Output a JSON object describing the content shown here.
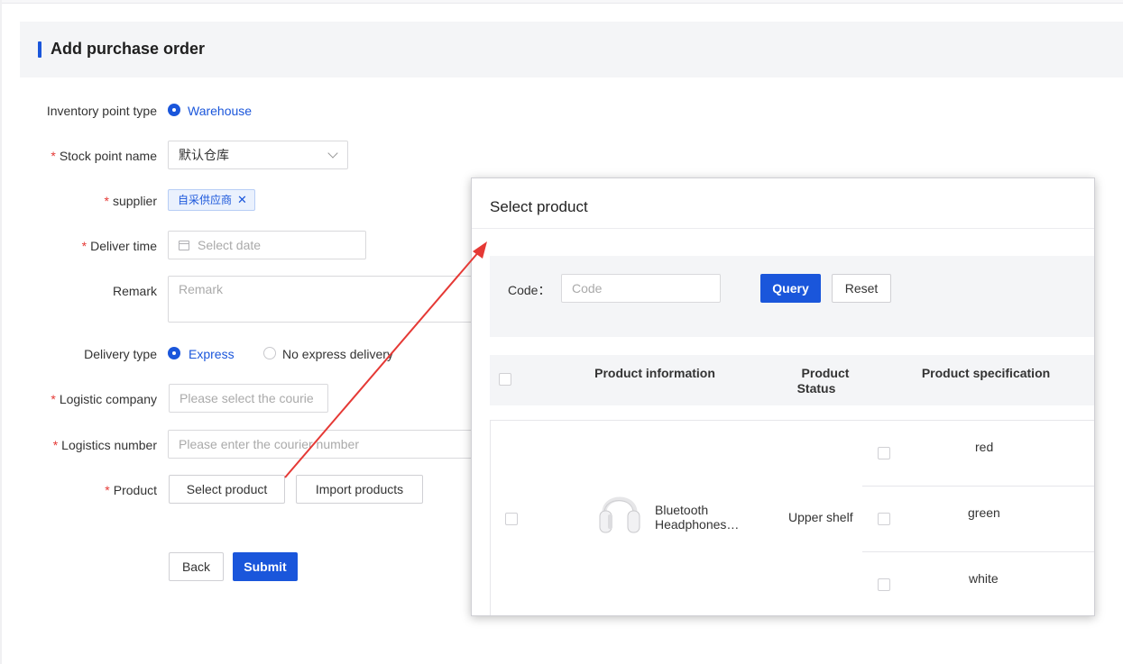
{
  "page": {
    "title": "Add purchase order"
  },
  "form": {
    "inventory_point_type": {
      "label": "Inventory point type",
      "option": "Warehouse"
    },
    "stock_point_name": {
      "label": "Stock point name",
      "value": "默认仓库"
    },
    "supplier": {
      "label": "supplier",
      "tag": "自采供应商"
    },
    "deliver_time": {
      "label": "Deliver time",
      "placeholder": "Select date"
    },
    "remark": {
      "label": "Remark",
      "placeholder": "Remark"
    },
    "delivery_type": {
      "label": "Delivery type",
      "option_express": "Express",
      "option_no_express": "No express delivery"
    },
    "logistic_company": {
      "label": "Logistic company",
      "placeholder": "Please select the courie"
    },
    "logistics_number": {
      "label": "Logistics number",
      "placeholder": "Please enter the courier number"
    },
    "product": {
      "label": "Product",
      "select_button": "Select product",
      "import_button": "Import products"
    },
    "back_button": "Back",
    "submit_button": "Submit"
  },
  "modal": {
    "title": "Select product",
    "code_label": "Code：",
    "code_placeholder": "Code",
    "query_button": "Query",
    "reset_button": "Reset",
    "columns": {
      "info": "Product information",
      "status_line1": "Product",
      "status_line2": "Status",
      "spec": "Product specification"
    },
    "rows": [
      {
        "name_line1": "Bluetooth",
        "name_line2": "Headphones…",
        "status": "Upper shelf",
        "specs": [
          "red",
          "green",
          "white"
        ]
      }
    ]
  },
  "colors": {
    "accent": "#1a56db",
    "required": "#e53935",
    "arrow": "#e53935"
  }
}
